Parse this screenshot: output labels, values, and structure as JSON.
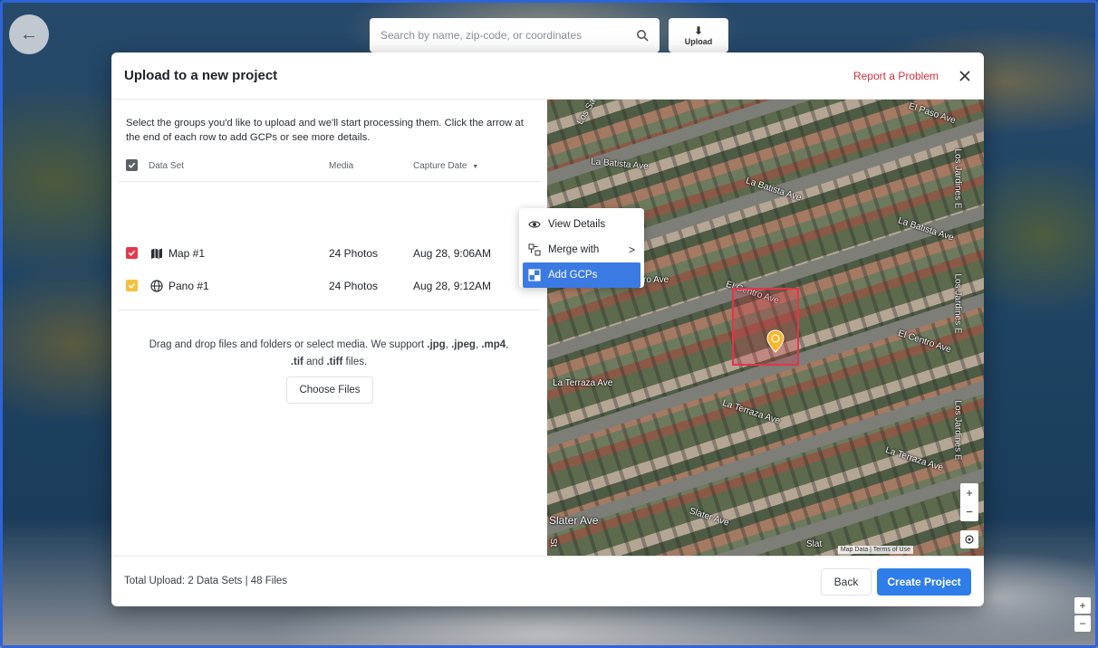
{
  "background": {
    "search_placeholder": "Search by name, zip-code, or coordinates",
    "upload_label": "Upload",
    "zoom_in": "+",
    "zoom_out": "−"
  },
  "modal": {
    "title": "Upload to a new project",
    "report_link": "Report a Problem",
    "intro_text": "Select the groups you'd like to upload and we'll start processing them. Click the arrow at the end of each row to add GCPs or see more details.",
    "table": {
      "headers": {
        "dataset": "Data Set",
        "media": "Media",
        "capture_date": "Capture Date"
      },
      "rows": [
        {
          "name": "Map #1",
          "media": "24 Photos",
          "date": "Aug 28, 9:06AM",
          "icon": "map-icon",
          "checkbox_color": "#e33a4c"
        },
        {
          "name": "Pano #1",
          "media": "24 Photos",
          "date": "Aug 28, 9:12AM",
          "icon": "globe-icon",
          "checkbox_color": "#f5c03c"
        }
      ],
      "row_more": "···"
    },
    "context_menu": {
      "items": [
        {
          "label": "View Details",
          "icon": "eye-icon"
        },
        {
          "label": "Merge with",
          "icon": "merge-icon",
          "chevron": ">"
        },
        {
          "label": "Add GCPs",
          "icon": "gcp-icon",
          "active": true
        }
      ]
    },
    "dropzone": {
      "text_prefix": "Drag and drop files and folders or select media. We support ",
      "ext1": ".jpg",
      "sep1": ", ",
      "ext2": ".jpeg",
      "sep2": ", ",
      "ext3": ".mp4",
      "sep3": ", ",
      "ext4": ".tif",
      "and": " and ",
      "ext5": ".tiff",
      "suffix": " files.",
      "choose_button": "Choose Files"
    },
    "map": {
      "streets": [
        "El Paso Ave",
        "La Batista Ave",
        "La Batista Ave",
        "La Batista Ave",
        "El Centro Ave",
        "El Centro Ave",
        "La Terraza Ave",
        "La Terraza Ave",
        "La Terraza Ave",
        "Slater Ave",
        "Slater Ave",
        "Los Jardines E",
        "Los Jardines E",
        "Los Jardines E",
        "Los Sa",
        "ro Ave",
        "Slat",
        "St"
      ],
      "zoom_in": "+",
      "zoom_out": "−",
      "attribution_data": "Map Data",
      "attribution_terms": "Terms of Use"
    },
    "footer": {
      "total": "Total Upload: 2 Data Sets | 48 Files",
      "back_button": "Back",
      "create_button": "Create Project"
    }
  }
}
